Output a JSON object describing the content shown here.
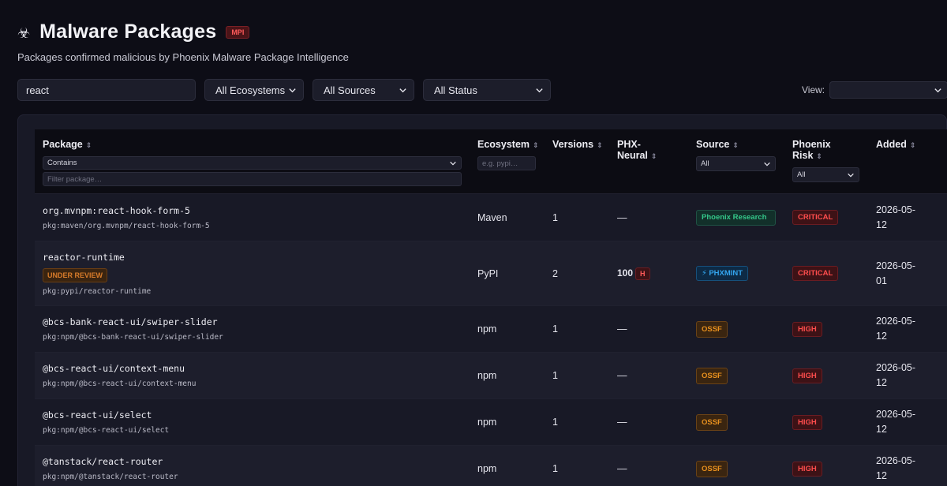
{
  "header": {
    "icon": "biohazard-icon",
    "title": "Malware Packages",
    "badge": "MPI",
    "subtitle": "Packages confirmed malicious by Phoenix Malware Package Intelligence"
  },
  "filters": {
    "search_value": "react",
    "ecosystem": "All Ecosystems",
    "source": "All Sources",
    "status": "All Status",
    "view_label": "View:",
    "view_value": ""
  },
  "table": {
    "columns": {
      "package": "Package",
      "ecosystem": "Ecosystem",
      "versions": "Versions",
      "neural": "PHX-Neural",
      "source": "Source",
      "risk": "Phoenix Risk",
      "added": "Added"
    },
    "column_filters": {
      "package_mode": "Contains",
      "package_placeholder": "Filter package…",
      "ecosystem_placeholder": "e.g. pypi…",
      "source_value": "All",
      "risk_value": "All"
    },
    "rows": [
      {
        "name": "org.mvnpm:react-hook-form-5",
        "purl": "pkg:maven/org.mvnpm/react-hook-form-5",
        "status": "",
        "ecosystem": "Maven",
        "versions": "1",
        "neural_score": "—",
        "neural_level": "",
        "source": "Phoenix Research",
        "risk": "CRITICAL",
        "added_line1": "2026-05-",
        "added_line2": "12"
      },
      {
        "name": "reactor-runtime",
        "purl": "pkg:pypi/reactor-runtime",
        "status": "UNDER REVIEW",
        "ecosystem": "PyPI",
        "versions": "2",
        "neural_score": "100",
        "neural_level": "H",
        "source": "PHXMINT",
        "risk": "CRITICAL",
        "added_line1": "2026-05-",
        "added_line2": "01"
      },
      {
        "name": "@bcs-bank-react-ui/swiper-slider",
        "purl": "pkg:npm/@bcs-bank-react-ui/swiper-slider",
        "status": "",
        "ecosystem": "npm",
        "versions": "1",
        "neural_score": "—",
        "neural_level": "",
        "source": "OSSF",
        "risk": "HIGH",
        "added_line1": "2026-05-",
        "added_line2": "12"
      },
      {
        "name": "@bcs-react-ui/context-menu",
        "purl": "pkg:npm/@bcs-react-ui/context-menu",
        "status": "",
        "ecosystem": "npm",
        "versions": "1",
        "neural_score": "—",
        "neural_level": "",
        "source": "OSSF",
        "risk": "HIGH",
        "added_line1": "2026-05-",
        "added_line2": "12"
      },
      {
        "name": "@bcs-react-ui/select",
        "purl": "pkg:npm/@bcs-react-ui/select",
        "status": "",
        "ecosystem": "npm",
        "versions": "1",
        "neural_score": "—",
        "neural_level": "",
        "source": "OSSF",
        "risk": "HIGH",
        "added_line1": "2026-05-",
        "added_line2": "12"
      },
      {
        "name": "@tanstack/react-router",
        "purl": "pkg:npm/@tanstack/react-router",
        "status": "",
        "ecosystem": "npm",
        "versions": "1",
        "neural_score": "—",
        "neural_level": "",
        "source": "OSSF",
        "risk": "HIGH",
        "added_line1": "2026-05-",
        "added_line2": "12"
      }
    ]
  },
  "colors": {
    "background": "#0d0d16",
    "panel": "#181926",
    "critical": "#ff4d4d",
    "phoenix_research": "#34c88a",
    "phxmint": "#33a5ee",
    "ossf": "#e8901e",
    "under_review": "#d77b2a"
  }
}
